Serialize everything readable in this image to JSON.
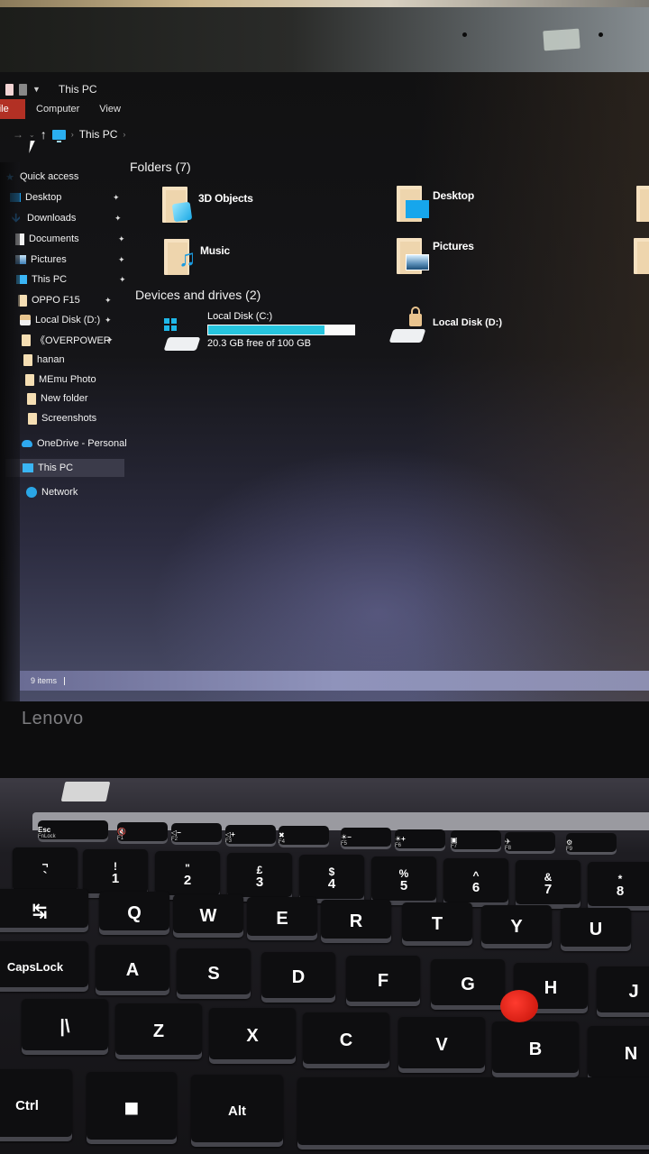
{
  "window": {
    "title": "This PC",
    "ribbon_tabs": [
      "File",
      "Computer",
      "View"
    ],
    "address": {
      "breadcrumb": [
        "This PC"
      ]
    }
  },
  "sidebar": {
    "quick_access_label": "Quick access",
    "items": [
      {
        "label": "Desktop",
        "icon": "desktop-icon",
        "pinned": true
      },
      {
        "label": "Downloads",
        "icon": "download-icon",
        "pinned": true
      },
      {
        "label": "Documents",
        "icon": "document-icon",
        "pinned": true
      },
      {
        "label": "Pictures",
        "icon": "pictures-icon",
        "pinned": true
      },
      {
        "label": "This PC",
        "icon": "computer-icon",
        "pinned": true
      },
      {
        "label": "OPPO F15",
        "icon": "folder-icon",
        "pinned": true
      },
      {
        "label": "Local Disk (D:)",
        "icon": "drive-icon",
        "pinned": true
      },
      {
        "label": "《OVERPOWEREE",
        "icon": "folder-icon",
        "pinned": true
      },
      {
        "label": "hanan",
        "icon": "folder-icon",
        "pinned": false
      },
      {
        "label": "MEmu Photo",
        "icon": "folder-icon",
        "pinned": false
      },
      {
        "label": "New folder",
        "icon": "folder-icon",
        "pinned": false
      },
      {
        "label": "Screenshots",
        "icon": "folder-icon",
        "pinned": false
      }
    ],
    "onedrive_label": "OneDrive - Personal",
    "thispc_label": "This PC",
    "network_label": "Network",
    "pin_glyph": "📌"
  },
  "content": {
    "folders_header": "Folders (7)",
    "folders": [
      {
        "label": "3D Objects",
        "overlay": "cube"
      },
      {
        "label": "Desktop",
        "overlay": "desktop"
      },
      {
        "label": "Music",
        "overlay": "music-note"
      },
      {
        "label": "Pictures",
        "overlay": "picture"
      }
    ],
    "drives_header": "Devices and drives (2)",
    "drives": [
      {
        "label": "Local Disk (C:)",
        "free_text": "20.3 GB free of 100 GB",
        "used_fraction": 0.797,
        "bar_color": "#26c4de"
      },
      {
        "label": "Local Disk (D:)"
      }
    ]
  },
  "status": {
    "items_count": "9 items"
  },
  "hardware": {
    "brand": "Lenovo",
    "fn_row": [
      {
        "top": "Esc",
        "sub": "FnLock"
      },
      {
        "top": "🔇",
        "sub": "F1"
      },
      {
        "top": "◁−",
        "sub": "F2"
      },
      {
        "top": "◁+",
        "sub": "F3"
      },
      {
        "top": "✖",
        "sub": "F4"
      },
      {
        "top": "☀−",
        "sub": "F5"
      },
      {
        "top": "☀+",
        "sub": "F6"
      },
      {
        "top": "▣",
        "sub": "F7"
      },
      {
        "top": "✈",
        "sub": "F8"
      },
      {
        "top": "⚙",
        "sub": "F9"
      }
    ],
    "number_row": [
      {
        "upper": "¬",
        "lower": "`"
      },
      {
        "upper": "!",
        "lower": "1"
      },
      {
        "upper": "\"",
        "lower": "2"
      },
      {
        "upper": "£",
        "lower": "3"
      },
      {
        "upper": "$",
        "lower": "4"
      },
      {
        "upper": "%",
        "lower": "5"
      },
      {
        "upper": "^",
        "lower": "6"
      },
      {
        "upper": "&",
        "lower": "7"
      },
      {
        "upper": "*",
        "lower": "8"
      }
    ],
    "row_q": [
      "↹",
      "Q",
      "W",
      "E",
      "R",
      "T",
      "Y",
      "U"
    ],
    "row_a": [
      "CapsLock",
      "A",
      "S",
      "D",
      "F",
      "G",
      "H",
      "J"
    ],
    "row_z": [
      "|\\",
      "Z",
      "X",
      "C",
      "V",
      "B",
      "N"
    ],
    "row_bottom": [
      "Ctrl",
      "■",
      "Alt",
      ""
    ]
  }
}
